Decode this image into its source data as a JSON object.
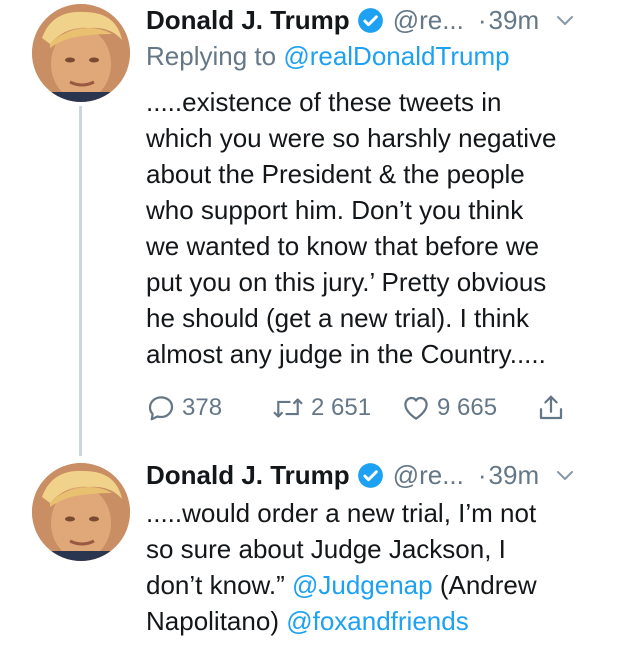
{
  "tweets": [
    {
      "author": {
        "name": "Donald J. Trump",
        "handle": "@re...",
        "verified": true
      },
      "time": "39m",
      "dot": "·",
      "replying_prefix": "Replying to ",
      "replying_to": "@realDonaldTrump",
      "lines": [
        ".....existence of these tweets in",
        "which you were so harshly negative",
        "about the President & the people",
        "who support him. Don’t you think",
        "we wanted to know that before we",
        "put you on this jury.’ Pretty obvious",
        "he should (get a new trial). I think",
        "almost any judge in the Country....."
      ],
      "actions": {
        "replies": "378",
        "retweets": "2 651",
        "likes": "9 665"
      }
    },
    {
      "author": {
        "name": "Donald J. Trump",
        "handle": "@re...",
        "verified": true
      },
      "time": "39m",
      "dot": "·",
      "line1": ".....would order a new trial, I’m not",
      "line2": "so sure about Judge Jackson, I",
      "line3_text": "don’t know.” ",
      "line3_mention": "@Judgenap",
      "line3_rest": " (Andrew",
      "line4_text": "Napolitano) ",
      "line4_mention": "@foxandfriends"
    }
  ],
  "icons": {
    "verified": "verified-badge-icon",
    "caret": "chevron-down-icon",
    "reply": "reply-icon",
    "retweet": "retweet-icon",
    "like": "heart-icon",
    "share": "share-icon"
  },
  "colors": {
    "link": "#1da1f2",
    "secondary": "#657786",
    "text": "#14171a",
    "thread": "#ccd6dd"
  }
}
